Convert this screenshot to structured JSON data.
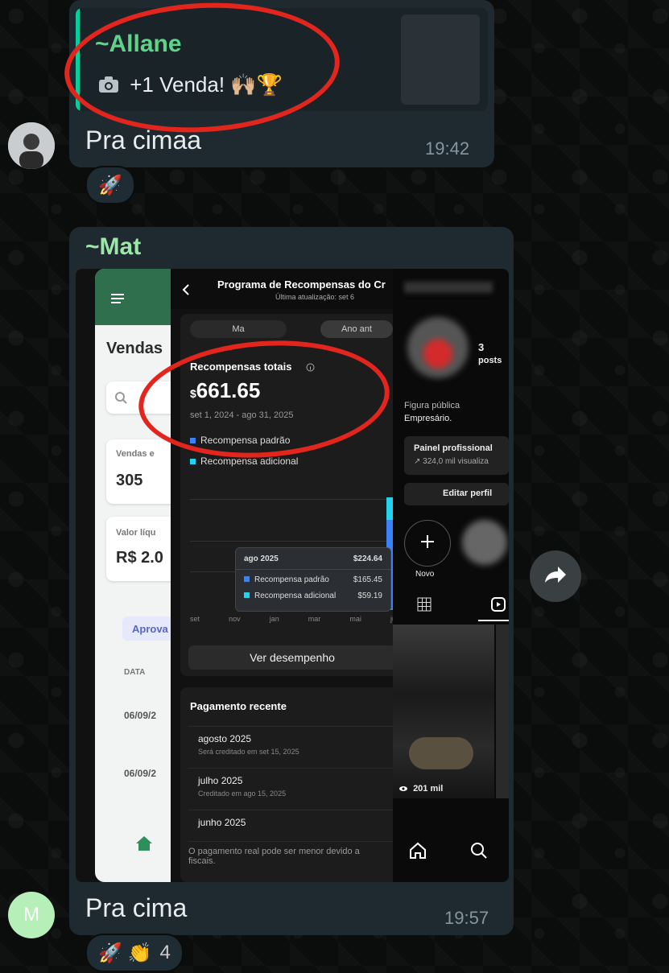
{
  "message1": {
    "quote_author": "~Allane",
    "quote_text": "+1 Venda! 🙌🏼🏆",
    "text": "Pra cimaa",
    "time": "19:42",
    "reactions": "🚀"
  },
  "message2": {
    "author": "~Mat",
    "text": "Pra cima",
    "time": "19:57",
    "reactions": "🚀 👏",
    "reaction_count": "4"
  },
  "avatar2_letter": "M",
  "screenshot": {
    "left_app": {
      "title": "Vendas",
      "sales_label": "Vendas e",
      "sales_value": "305",
      "net_label": "Valor líqu",
      "net_value": "R$ 2.0",
      "status_chip": "Aprova",
      "column_header": "DATA",
      "row_dates": [
        "06/09/2",
        "06/09/2"
      ]
    },
    "rewards": {
      "title": "Programa de Recompensas do Cr",
      "subtitle": "Última atualização: set 6",
      "segment_left": "Ma",
      "segment_right": "Ano ant",
      "total_label": "Recompensas totais",
      "total_currency": "$",
      "total_value": "661.65",
      "date_range": "set 1, 2024 - ago 31, 2025",
      "legend": [
        "Recompensa padrão",
        "Recompensa adicional"
      ],
      "x_ticks": [
        "set",
        "nov",
        "jan",
        "mar",
        "mai",
        "jul"
      ],
      "tooltip": {
        "month": "ago 2025",
        "total": "$224.64",
        "rows": [
          {
            "label": "Recompensa padrão",
            "value": "$165.45"
          },
          {
            "label": "Recompensa adicional",
            "value": "$59.19"
          }
        ]
      },
      "button": "Ver desempenho",
      "recent_payment_title": "Pagamento recente",
      "payments": [
        {
          "month": "agosto 2025",
          "note": "Será creditado em set 15, 2025"
        },
        {
          "month": "julho 2025",
          "note": "Creditado em ago 15, 2025"
        },
        {
          "month": "junho 2025",
          "note": ""
        }
      ],
      "footer_note_1": "O pagamento real pode ser menor devido a",
      "footer_note_2": "fiscais."
    },
    "profile": {
      "posts_count": "3",
      "posts_label": "posts",
      "category": "Figura pública",
      "bio": "Empresário.",
      "panel_title": "Painel profissional",
      "panel_sub": "↗ 324,0 mil visualiza",
      "edit_button": "Editar perfil",
      "new_label": "Novo",
      "views": "201 mil"
    }
  },
  "colors": {
    "bubble": "#1e2a30",
    "accent_green": "#5fd38a",
    "annotation_red": "#e3261d",
    "legend_blue": "#3b82f6",
    "legend_cyan": "#22d3ee"
  }
}
